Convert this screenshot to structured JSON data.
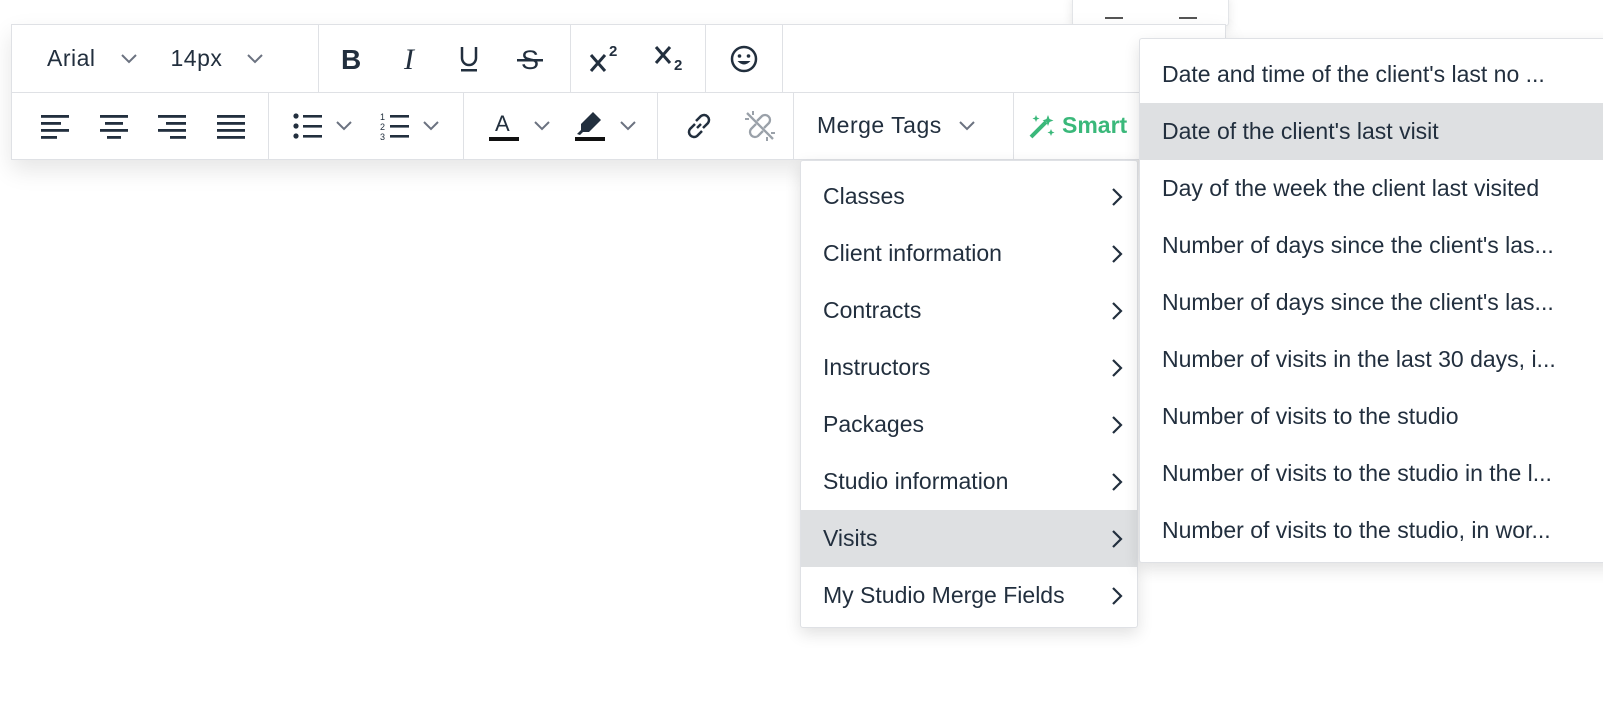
{
  "toolbar": {
    "font_family": "Arial",
    "font_size": "14px",
    "merge_tags_label": "Merge Tags",
    "smart_label": "Smart",
    "accent_color": "#3ab87a",
    "icons": [
      "bold-icon",
      "italic-icon",
      "underline-icon",
      "strikethrough-icon",
      "superscript-icon",
      "subscript-icon",
      "emoji-icon",
      "align-left-icon",
      "align-center-icon",
      "align-right-icon",
      "align-justify-icon",
      "bullet-list-icon",
      "numbered-list-icon",
      "text-color-icon",
      "highlight-color-icon",
      "link-icon",
      "unlink-icon",
      "magic-wand-icon"
    ]
  },
  "merge_menu": {
    "items": [
      {
        "label": "Classes"
      },
      {
        "label": "Client information"
      },
      {
        "label": "Contracts"
      },
      {
        "label": "Instructors"
      },
      {
        "label": "Packages"
      },
      {
        "label": "Studio information"
      },
      {
        "label": "Visits"
      },
      {
        "label": "My Studio Merge Fields"
      }
    ],
    "active_index": 6
  },
  "visits_submenu": {
    "items": [
      {
        "label": "Date and time of the client's last no ..."
      },
      {
        "label": "Date of the client's last visit"
      },
      {
        "label": "Day of the week the client last visited"
      },
      {
        "label": "Number of days since the client's las..."
      },
      {
        "label": "Number of days since the client's las..."
      },
      {
        "label": "Number of visits in the last 30 days, i..."
      },
      {
        "label": "Number of visits to the studio"
      },
      {
        "label": "Number of visits to the studio in the l..."
      },
      {
        "label": "Number of visits to the studio, in wor..."
      }
    ],
    "active_index": 1
  }
}
